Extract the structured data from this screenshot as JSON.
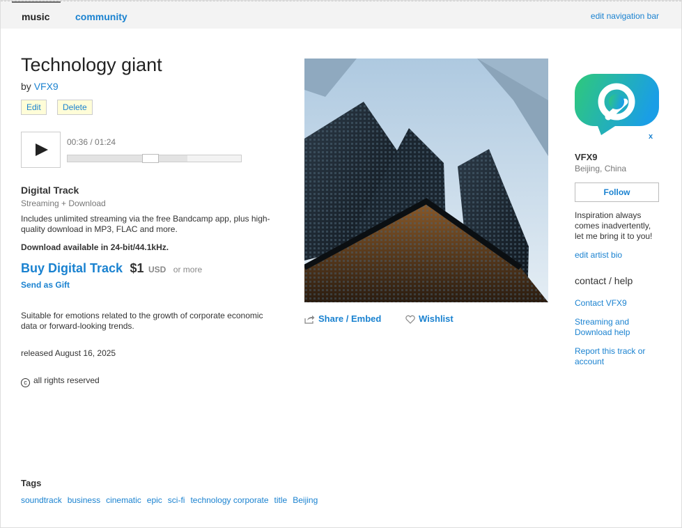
{
  "nav": {
    "music": "music",
    "community": "community",
    "edit_nav": "edit navigation bar"
  },
  "track": {
    "title": "Technology giant",
    "by": "by",
    "artist": "VFX9",
    "edit_label": "Edit",
    "delete_label": "Delete"
  },
  "player": {
    "time": "00:36 / 01:24",
    "progress_fraction": 0.43,
    "buffered_fraction": 0.69
  },
  "digital": {
    "title": "Digital Track",
    "subtitle": "Streaming + Download",
    "description": "Includes unlimited streaming via the free Bandcamp app, plus high-quality download in MP3, FLAC and more.",
    "download_note": "Download available in 24-bit/44.1kHz.",
    "buy_label": "Buy Digital Track",
    "price": "$1",
    "currency": "USD",
    "or_more": "or more",
    "gift_label": "Send as Gift"
  },
  "about": "Suitable for emotions related to the growth of corporate economic data or forward-looking trends.",
  "released": "released August 16, 2025",
  "rights": "all rights reserved",
  "actions": {
    "share": "Share / Embed",
    "wishlist": "Wishlist"
  },
  "sidebar": {
    "close": "x",
    "artist_name": "VFX9",
    "location": "Beijing, China",
    "follow": "Follow",
    "bio": "Inspiration always comes inadvertently, let me bring it to you!",
    "edit_bio": "edit artist bio",
    "contact_title": "contact / help",
    "links": [
      "Contact VFX9",
      "Streaming and Download help",
      "Report this track or account"
    ]
  },
  "tags": {
    "title": "Tags",
    "items": [
      "soundtrack",
      "business",
      "cinematic",
      "epic",
      "sci-fi",
      "technology corporate",
      "title",
      "Beijing"
    ]
  },
  "colors": {
    "link": "#1a82d0",
    "admin_button_bg": "#fffdd8",
    "avatar_gradient_start": "#2fc97a",
    "avatar_gradient_end": "#1a9ee6"
  }
}
